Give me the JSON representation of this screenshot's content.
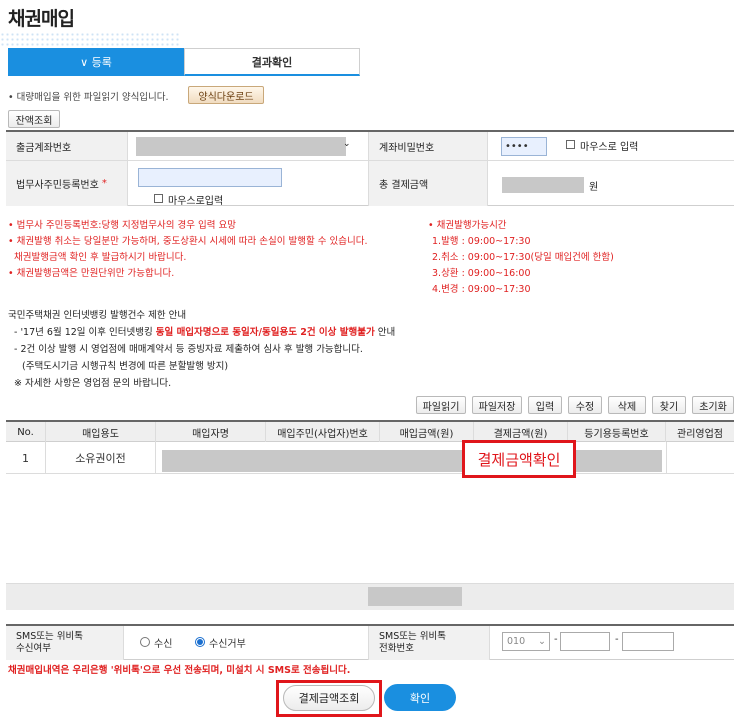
{
  "page": {
    "title": "채권매입"
  },
  "tabs": {
    "register": "∨ 등록",
    "result": "결과확인"
  },
  "notice_download": "• 대량매입을 위한 파일읽기 양식입니다.",
  "buttons": {
    "download_form": "양식다운로드",
    "balance_inquiry": "잔액조회",
    "file_read": "파일읽기",
    "file_save": "파일저장",
    "input": "입력",
    "edit": "수정",
    "delete": "삭제",
    "find": "찾기",
    "reset": "초기화",
    "payment_inquiry": "결제금액조회",
    "confirm": "확인"
  },
  "form": {
    "account_label": "출금계좌번호",
    "password_label": "계좌비밀번호",
    "password_value": "••••",
    "mouse_input_1": "마우스로 입력",
    "lawyer_reg_label": "법무사주민등록번호",
    "required_mark": "*",
    "mouse_input_2": "마우스로입력",
    "total_label": "총 결제금액",
    "won": "원"
  },
  "notices_left": [
    "• 법무사 주민등록번호:당행 지정법무사의 경우 입력 요망",
    "• 채권발행 취소는 당일분만 가능하며, 중도상환시 시세에 따라 손실이 발행할 수 있습니다.",
    "  채권발행금액 확인 후 발급하시기 바랍니다.",
    "• 채권발행금액은 만원단위만 가능합니다."
  ],
  "notices_right": {
    "title": "• 채권발행가능시간",
    "items": [
      "1.발행 : 09:00~17:30",
      "2.취소 : 09:00~17:30(당일 매입건에 한함)",
      "3.상환 : 09:00~16:00",
      "4.변경 : 09:00~17:30"
    ]
  },
  "limit_notice": {
    "title": "국민주택채권 인터넷뱅킹 발행건수 제한 안내",
    "line1_pre": "- '17년 6월 12일 이후 인터넷뱅킹 ",
    "line1_red": "동일 매입자명으로 동일자/동일용도 2건 이상 발행불가",
    "line1_post": " 안내",
    "line2": "- 2건 이상 발행 시 영업점에 매매계약서 등 증빙자료 제출하여 심사 후 발행 가능합니다.",
    "line3": "(주택도시기금 시행규칙 변경에 따른 분할발행 방지)",
    "line4": "※ 자세한 사항은 영업점 문의 바랍니다."
  },
  "grid": {
    "headers": [
      "No.",
      "매입용도",
      "매입자명",
      "매입주민(사업자)번호",
      "매입금액(원)",
      "결제금액(원)",
      "등기용등록번호",
      "관리영업점"
    ],
    "rows": [
      {
        "no": "1",
        "purpose": "소유권이전"
      }
    ]
  },
  "annotation": "결제금액확인",
  "sms": {
    "receive_label_1": "SMS또는 위비톡",
    "receive_label_2": "수신여부",
    "opt_receive": "수신",
    "opt_reject": "수신거부",
    "phone_label_1": "SMS또는 위비톡",
    "phone_label_2": "전화번호",
    "phone_prefix": "010",
    "dash": "-"
  },
  "bottom_notice": "채권매입내역은 우리은행 '위비톡'으로 우선 전송되며, 미설치 시 SMS로 전송됩니다."
}
